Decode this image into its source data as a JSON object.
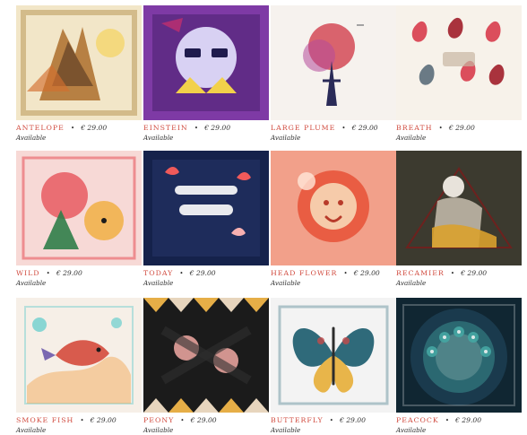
{
  "products": [
    {
      "name": "ANTELOPE",
      "price": "€ 29.00",
      "status": "Available",
      "icon": "antelope-scarf-image",
      "colors": [
        "#f2e6c8",
        "#b37a3c",
        "#4b2e1d",
        "#f4d66b",
        "#d26f2e"
      ]
    },
    {
      "name": "EINSTEIN",
      "price": "€ 29.00",
      "status": "Available",
      "icon": "einstein-scarf-image",
      "colors": [
        "#7e3aa5",
        "#e6e3ff",
        "#cc2f6b",
        "#1f1b4d",
        "#f2d14a"
      ]
    },
    {
      "name": "LARGE PLUME",
      "price": "€ 29.00",
      "status": "Available",
      "icon": "plume-scarf-image",
      "colors": [
        "#f6f2ee",
        "#d44a56",
        "#2a2b58",
        "#b54b9a",
        "#a3a3a3"
      ]
    },
    {
      "name": "BREATH",
      "price": "€ 29.00",
      "status": "Available",
      "icon": "breath-scarf-image",
      "colors": [
        "#f7f2ea",
        "#d93d4d",
        "#5b6e7b",
        "#a11f2b",
        "#c7b6a3"
      ]
    },
    {
      "name": "WILD",
      "price": "€ 29.00",
      "status": "Available",
      "icon": "wild-scarf-image",
      "colors": [
        "#f7d9d6",
        "#e85a61",
        "#2f7d49",
        "#f1b14d",
        "#1c1c1c"
      ]
    },
    {
      "name": "TODAY",
      "price": "€ 29.00",
      "status": "Available",
      "icon": "today-scarf-image",
      "colors": [
        "#15224b",
        "#ffffff",
        "#f05a5a",
        "#3b4a8a",
        "#f8b0b0"
      ]
    },
    {
      "name": "HEAD FLOWER",
      "price": "€ 29.00",
      "status": "Available",
      "icon": "head-flower-scarf-image",
      "colors": [
        "#f2a08a",
        "#e85a3f",
        "#f7d7b6",
        "#b83a2a",
        "#ffe7d8"
      ]
    },
    {
      "name": "RECAMIER",
      "price": "€ 29.00",
      "status": "Available",
      "icon": "recamier-scarf-image",
      "colors": [
        "#3c3a2f",
        "#bfb7a7",
        "#d9a12d",
        "#e8e3db",
        "#7e1a1a"
      ]
    },
    {
      "name": "SMOKE FISH",
      "price": "€ 29.00",
      "status": "Available",
      "icon": "smoke-fish-scarf-image",
      "colors": [
        "#f6efe7",
        "#41c4c7",
        "#f2a14a",
        "#d85b4d",
        "#7a68b1"
      ]
    },
    {
      "name": "PEONY",
      "price": "€ 29.00",
      "status": "Available",
      "icon": "peony-scarf-image",
      "colors": [
        "#1b1b1b",
        "#f1b64a",
        "#f2e0c6",
        "#e6a29c",
        "#2f2f2f"
      ]
    },
    {
      "name": "BUTTERFLY",
      "price": "€ 29.00",
      "status": "Available",
      "icon": "butterfly-scarf-image",
      "colors": [
        "#f3f3f3",
        "#2f6a7a",
        "#e8b54a",
        "#2c2c2c",
        "#c44b4b"
      ]
    },
    {
      "name": "PEACOCK",
      "price": "€ 29.00",
      "status": "Available",
      "icon": "peacock-scarf-image",
      "colors": [
        "#1b3c4f",
        "#45a7a3",
        "#c7ddd8",
        "#102632",
        "#f0f5f4"
      ]
    }
  ]
}
